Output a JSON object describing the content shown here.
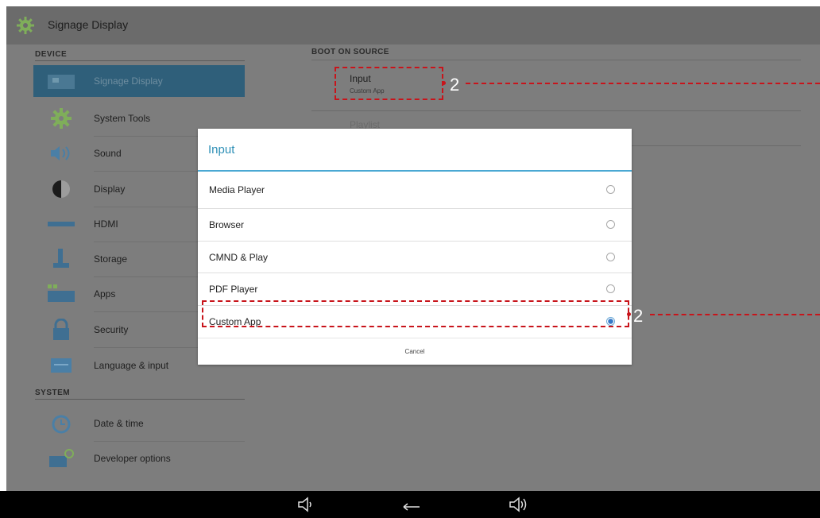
{
  "header": {
    "title": "Signage Display",
    "icon": "gear-icon"
  },
  "sidebar": {
    "device_header": "DEVICE",
    "system_header": "SYSTEM",
    "items": [
      {
        "label": "Signage Display",
        "icon": "display-icon",
        "selected": true
      },
      {
        "label": "System Tools",
        "icon": "gear-icon"
      },
      {
        "label": "Sound",
        "icon": "speaker-icon"
      },
      {
        "label": "Display",
        "icon": "contrast-icon"
      },
      {
        "label": "HDMI",
        "icon": "hdmi-icon"
      },
      {
        "label": "Storage",
        "icon": "storage-icon"
      },
      {
        "label": "Apps",
        "icon": "apps-icon"
      },
      {
        "label": "Security",
        "icon": "lock-icon"
      },
      {
        "label": "Language & input",
        "icon": "keyboard-icon"
      },
      {
        "label": "Date & time",
        "icon": "clock-icon"
      },
      {
        "label": "Developer options",
        "icon": "developer-icon"
      }
    ]
  },
  "main": {
    "section_header": "BOOT ON SOURCE",
    "input_setting": {
      "title": "Input",
      "summary": "Custom App"
    },
    "playlist_setting": {
      "title": "Playlist"
    }
  },
  "dialog": {
    "title": "Input",
    "options": [
      {
        "label": "Media Player",
        "checked": false
      },
      {
        "label": "Browser",
        "checked": false
      },
      {
        "label": "CMND & Play",
        "checked": false
      },
      {
        "label": "PDF Player",
        "checked": false
      },
      {
        "label": "Custom App",
        "checked": true
      }
    ],
    "cancel_label": "Cancel"
  },
  "annotations": {
    "callout_top": "2",
    "callout_dialog": "2",
    "color": "#c8141b"
  },
  "navbar": {
    "left_icon": "volume-down-icon",
    "center_icon": "back-icon",
    "right_icon": "volume-up-icon"
  },
  "colors": {
    "accent": "#2d8fb6",
    "selected_nav": "#2f5f7a"
  }
}
